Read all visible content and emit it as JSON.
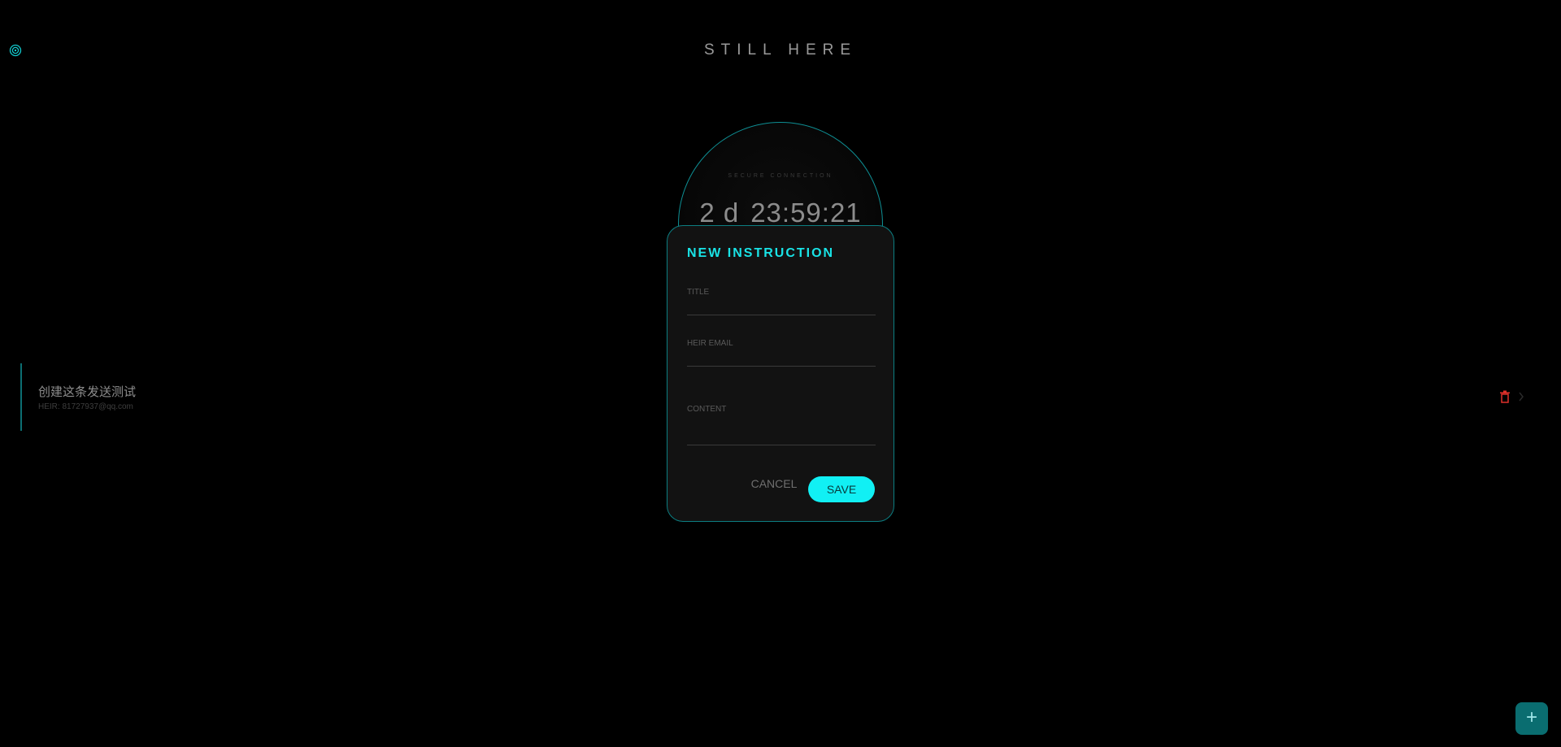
{
  "app": {
    "title": "STILL HERE"
  },
  "icons": {
    "logo": "target-icon",
    "delete": "trash-icon",
    "chevron": "chevron-right-icon",
    "add": "plus-icon"
  },
  "colors": {
    "accent": "#11f0f4",
    "accent_dark": "#0c7e82",
    "background": "#000000",
    "modal_bg": "#121212",
    "danger": "#e0302a"
  },
  "countdown": {
    "label": "SECURE CONNECTION",
    "days": "2 d",
    "time": "23:59:21"
  },
  "instructions": [
    {
      "title": "创建这条发送测试",
      "heir": "HEIR: 81727937@qq.com"
    }
  ],
  "fab": {
    "label": "+"
  },
  "modal": {
    "title": "NEW INSTRUCTION",
    "fields": {
      "title_label": "TITLE",
      "title_value": "",
      "email_label": "HEIR EMAIL",
      "email_value": "",
      "content_label": "CONTENT",
      "content_value": ""
    },
    "cancel_label": "CANCEL",
    "save_label": "SAVE"
  }
}
